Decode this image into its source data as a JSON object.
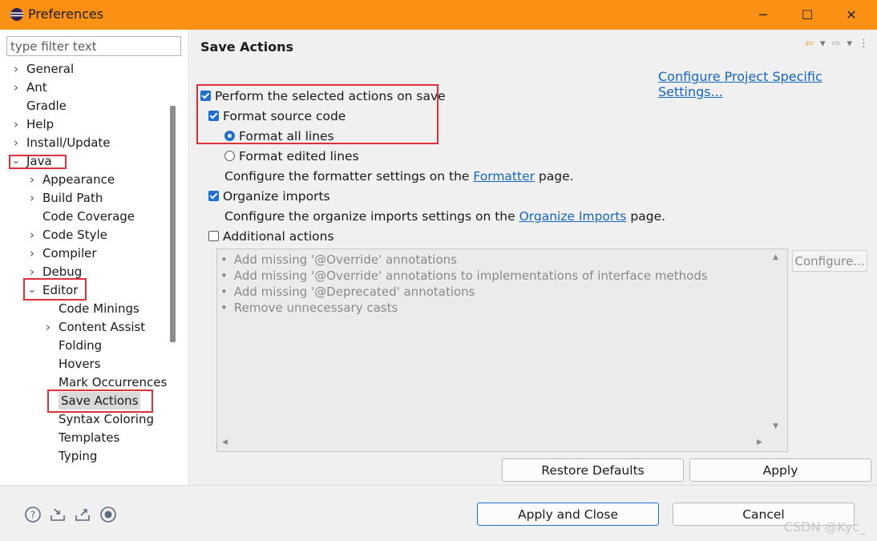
{
  "window": {
    "title": "Preferences",
    "controls": {
      "minimize": "─",
      "maximize": "☐",
      "close": "✕"
    }
  },
  "filter": {
    "placeholder": "type filter text"
  },
  "tree": {
    "items": [
      {
        "label": "General",
        "level": 0,
        "expander": "collapsed"
      },
      {
        "label": "Ant",
        "level": 0,
        "expander": "collapsed"
      },
      {
        "label": "Gradle",
        "level": 0,
        "expander": "none"
      },
      {
        "label": "Help",
        "level": 0,
        "expander": "collapsed"
      },
      {
        "label": "Install/Update",
        "level": 0,
        "expander": "collapsed"
      },
      {
        "label": "Java",
        "level": 0,
        "expander": "expanded"
      },
      {
        "label": "Appearance",
        "level": 1,
        "expander": "collapsed"
      },
      {
        "label": "Build Path",
        "level": 1,
        "expander": "collapsed"
      },
      {
        "label": "Code Coverage",
        "level": 1,
        "expander": "none"
      },
      {
        "label": "Code Style",
        "level": 1,
        "expander": "collapsed"
      },
      {
        "label": "Compiler",
        "level": 1,
        "expander": "collapsed"
      },
      {
        "label": "Debug",
        "level": 1,
        "expander": "collapsed"
      },
      {
        "label": "Editor",
        "level": 1,
        "expander": "expanded"
      },
      {
        "label": "Code Minings",
        "level": 2,
        "expander": "none"
      },
      {
        "label": "Content Assist",
        "level": 2,
        "expander": "collapsed"
      },
      {
        "label": "Folding",
        "level": 2,
        "expander": "none"
      },
      {
        "label": "Hovers",
        "level": 2,
        "expander": "none"
      },
      {
        "label": "Mark Occurrences",
        "level": 2,
        "expander": "none"
      },
      {
        "label": "Save Actions",
        "level": 2,
        "expander": "none",
        "selected": true
      },
      {
        "label": "Syntax Coloring",
        "level": 2,
        "expander": "none"
      },
      {
        "label": "Templates",
        "level": 2,
        "expander": "none"
      },
      {
        "label": "Typing",
        "level": 2,
        "expander": "none"
      }
    ]
  },
  "page": {
    "title": "Save Actions",
    "config_link": "Configure Project Specific Settings...",
    "perform_label": "Perform the selected actions on save",
    "perform_checked": true,
    "format_label": "Format source code",
    "format_checked": true,
    "format_all_label": "Format all lines",
    "format_edited_label": "Format edited lines",
    "formatter_prefix": "Configure the formatter settings on the ",
    "formatter_link": "Formatter",
    "formatter_suffix": " page.",
    "organize_label": "Organize imports",
    "organize_checked": true,
    "organize_prefix": "Configure the organize imports settings on the ",
    "organize_link": "Organize Imports",
    "organize_suffix": " page.",
    "additional_label": "Additional actions",
    "additional_checked": false,
    "additional_items": [
      "Add missing '@Override' annotations",
      "Add missing '@Override' annotations to implementations of interface methods",
      "Add missing '@Deprecated' annotations",
      "Remove unnecessary casts"
    ],
    "configure_label": "Configure...",
    "restore_label": "Restore Defaults",
    "apply_label": "Apply"
  },
  "footer": {
    "apply_close_label": "Apply and Close",
    "cancel_label": "Cancel"
  },
  "watermark": "CSDN @Kyc_",
  "colors": {
    "titlebar": "#fb9114",
    "accent": "#1f6fd1",
    "link": "#1565c0",
    "highlight": "#e0303a"
  }
}
